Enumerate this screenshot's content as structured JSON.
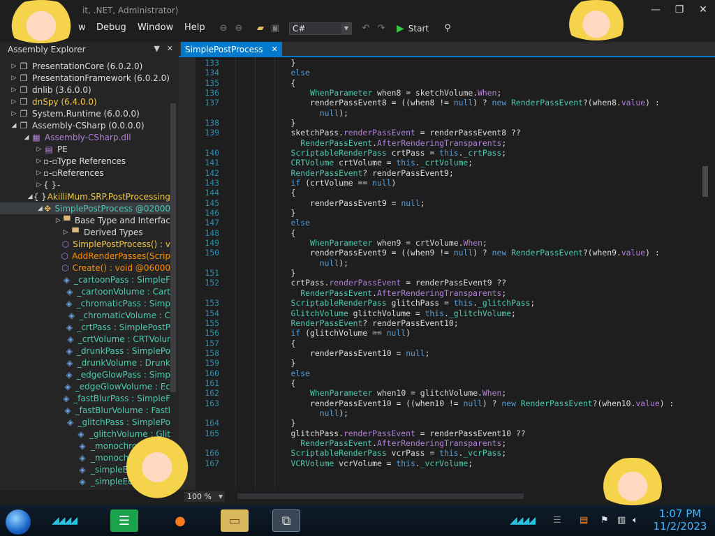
{
  "window": {
    "title": "dnSpy v6.4.0 (64-bit, .NET, Administrator)",
    "title_visible_fragment": "it, .NET, Administrator)",
    "controls": {
      "minimize": "—",
      "maximize": "❐",
      "close": "✕"
    }
  },
  "menu": {
    "items": [
      "w",
      "Debug",
      "Window",
      "Help"
    ]
  },
  "toolbar": {
    "language": "C#",
    "start_label": "Start"
  },
  "explorer": {
    "title": "Assembly Explorer",
    "items": [
      {
        "text": "PresentationCore (6.0.2.0)",
        "icon": "assembly-icon",
        "tw": "▷",
        "color": "c-white"
      },
      {
        "text": "PresentationFramework (6.0.2.0)",
        "icon": "assembly-icon",
        "tw": "▷",
        "color": "c-white"
      },
      {
        "text": "dnlib (3.6.0.0)",
        "icon": "assembly-icon",
        "tw": "▷",
        "color": "c-white"
      },
      {
        "text": "dnSpy (6.4.0.0)",
        "icon": "assembly-icon",
        "tw": "▷",
        "color": "c-yellow"
      },
      {
        "text": "System.Runtime (6.0.0.0)",
        "icon": "assembly-icon",
        "tw": "▷",
        "color": "c-white"
      },
      {
        "text": "Assembly-CSharp (0.0.0.0)",
        "icon": "assembly-icon",
        "tw": "◢",
        "color": "c-white"
      },
      {
        "text": "Assembly-CSharp.dll",
        "icon": "module-icon",
        "tw": "◢",
        "color": "c-purple"
      },
      {
        "text": "PE",
        "icon": "pe-icon",
        "tw": "▷",
        "color": "c-white"
      },
      {
        "text": "Type References",
        "icon": "reference-icon",
        "tw": "▷",
        "color": "c-white"
      },
      {
        "text": "References",
        "icon": "reference-icon",
        "tw": "▷",
        "color": "c-white"
      },
      {
        "text": "-",
        "icon": "namespace-icon",
        "tw": "▷",
        "color": "c-white"
      },
      {
        "text": "AkilliMum.SRP.PostProcessing",
        "icon": "namespace-icon",
        "tw": "◢",
        "color": "c-yellow"
      },
      {
        "text": "SimplePostProcess @02000",
        "icon": "class-icon",
        "tw": "◢",
        "color": "c-teal"
      },
      {
        "text": "Base Type and Interfac",
        "icon": "folder-icon",
        "tw": "▷",
        "color": "c-white"
      },
      {
        "text": "Derived Types",
        "icon": "folder-icon",
        "tw": "▷",
        "color": "c-white"
      },
      {
        "text": "SimplePostProcess() : v",
        "icon": "method-icon",
        "tw": "",
        "color": "c-yellow"
      },
      {
        "text": "AddRenderPasses(Scrip",
        "icon": "method-icon",
        "tw": "",
        "color": "c-orange"
      },
      {
        "text": "Create() : void @06000",
        "icon": "method-icon",
        "tw": "",
        "color": "c-orange"
      },
      {
        "text": "_cartoonPass : SimpleF",
        "icon": "field-icon",
        "tw": "",
        "color": "c-teal"
      },
      {
        "text": "_cartoonVolume : Cart",
        "icon": "field-icon",
        "tw": "",
        "color": "c-teal"
      },
      {
        "text": "_chromaticPass : Simp",
        "icon": "field-icon",
        "tw": "",
        "color": "c-teal"
      },
      {
        "text": "_chromaticVolume : C",
        "icon": "field-icon",
        "tw": "",
        "color": "c-teal"
      },
      {
        "text": "_crtPass : SimplePostP",
        "icon": "field-icon",
        "tw": "",
        "color": "c-teal"
      },
      {
        "text": "_crtVolume : CRTVolur",
        "icon": "field-icon",
        "tw": "",
        "color": "c-teal"
      },
      {
        "text": "_drunkPass : SimplePo",
        "icon": "field-icon",
        "tw": "",
        "color": "c-teal"
      },
      {
        "text": "_drunkVolume : Drunk",
        "icon": "field-icon",
        "tw": "",
        "color": "c-teal"
      },
      {
        "text": "_edgeGlowPass : Simp",
        "icon": "field-icon",
        "tw": "",
        "color": "c-teal"
      },
      {
        "text": "_edgeGlowVolume : Ec",
        "icon": "field-icon",
        "tw": "",
        "color": "c-teal"
      },
      {
        "text": "_fastBlurPass : SimpleF",
        "icon": "field-icon",
        "tw": "",
        "color": "c-teal"
      },
      {
        "text": "_fastBlurVolume : Fastl",
        "icon": "field-icon",
        "tw": "",
        "color": "c-teal"
      },
      {
        "text": "_glitchPass : SimplePo",
        "icon": "field-icon",
        "tw": "",
        "color": "c-teal"
      },
      {
        "text": "_glitchVolume : Glit",
        "icon": "field-icon",
        "tw": "",
        "color": "c-teal"
      },
      {
        "text": "_monochron",
        "icon": "field-icon",
        "tw": "",
        "color": "c-teal"
      },
      {
        "text": "_monochro",
        "icon": "field-icon",
        "tw": "",
        "color": "c-teal"
      },
      {
        "text": "_simpleEdge",
        "icon": "field-icon",
        "tw": "",
        "color": "c-teal"
      },
      {
        "text": "_simpleEdge",
        "icon": "field-icon",
        "tw": "",
        "color": "c-teal"
      }
    ]
  },
  "tab": {
    "label": "SimplePostProcess",
    "close": "✕"
  },
  "code": {
    "lines": [
      {
        "n": "133",
        "i": 4,
        "h": "}"
      },
      {
        "n": "134",
        "i": 4,
        "h": "<span class='kw'>else</span>"
      },
      {
        "n": "135",
        "i": 4,
        "h": "{"
      },
      {
        "n": "136",
        "i": 8,
        "h": "<span class='ty'>WhenParameter</span> when8 = sketchVolume.<span class='mem'>When</span>;"
      },
      {
        "n": "137",
        "i": 8,
        "h": "renderPassEvent8 = ((when8 != <span class='kw'>null</span>) ? <span class='kw'>new</span> <span class='ty'>RenderPassEvent</span>?(when8.<span class='mem'>value</span>) :"
      },
      {
        "n": "",
        "i": 10,
        "h": "<span class='kw'>null</span>);"
      },
      {
        "n": "138",
        "i": 4,
        "h": "}"
      },
      {
        "n": "139",
        "i": 4,
        "h": "sketchPass.<span class='mem'>renderPassEvent</span> = renderPassEvent8 ??"
      },
      {
        "n": "",
        "i": 6,
        "h": "<span class='ty'>RenderPassEvent</span>.<span class='mem'>AfterRenderingTransparents</span>;"
      },
      {
        "n": "140",
        "i": 4,
        "h": "<span class='ty'>ScriptableRenderPass</span> crtPass = <span class='kw'>this</span>.<span class='ty'>_crtPass</span>;"
      },
      {
        "n": "141",
        "i": 4,
        "h": "<span class='ty'>CRTVolume</span> crtVolume = <span class='kw'>this</span>.<span class='ty'>_crtVolume</span>;"
      },
      {
        "n": "142",
        "i": 4,
        "h": "<span class='ty'>RenderPassEvent</span>? renderPassEvent9;"
      },
      {
        "n": "143",
        "i": 4,
        "h": "<span class='kw'>if</span> (crtVolume == <span class='kw'>null</span>)"
      },
      {
        "n": "144",
        "i": 4,
        "h": "{"
      },
      {
        "n": "145",
        "i": 8,
        "h": "renderPassEvent9 = <span class='kw'>null</span>;"
      },
      {
        "n": "146",
        "i": 4,
        "h": "}"
      },
      {
        "n": "147",
        "i": 4,
        "h": "<span class='kw'>else</span>"
      },
      {
        "n": "148",
        "i": 4,
        "h": "{"
      },
      {
        "n": "149",
        "i": 8,
        "h": "<span class='ty'>WhenParameter</span> when9 = crtVolume.<span class='mem'>When</span>;"
      },
      {
        "n": "150",
        "i": 8,
        "h": "renderPassEvent9 = ((when9 != <span class='kw'>null</span>) ? <span class='kw'>new</span> <span class='ty'>RenderPassEvent</span>?(when9.<span class='mem'>value</span>) :"
      },
      {
        "n": "",
        "i": 10,
        "h": "<span class='kw'>null</span>);"
      },
      {
        "n": "151",
        "i": 4,
        "h": "}"
      },
      {
        "n": "152",
        "i": 4,
        "h": "crtPass.<span class='mem'>renderPassEvent</span> = renderPassEvent9 ??"
      },
      {
        "n": "",
        "i": 6,
        "h": "<span class='ty'>RenderPassEvent</span>.<span class='mem'>AfterRenderingTransparents</span>;"
      },
      {
        "n": "153",
        "i": 4,
        "h": "<span class='ty'>ScriptableRenderPass</span> glitchPass = <span class='kw'>this</span>.<span class='ty'>_glitchPass</span>;"
      },
      {
        "n": "154",
        "i": 4,
        "h": "<span class='ty'>GlitchVolume</span> glitchVolume = <span class='kw'>this</span>.<span class='ty'>_glitchVolume</span>;"
      },
      {
        "n": "155",
        "i": 4,
        "h": "<span class='ty'>RenderPassEvent</span>? renderPassEvent10;"
      },
      {
        "n": "156",
        "i": 4,
        "h": "<span class='kw'>if</span> (glitchVolume == <span class='kw'>null</span>)"
      },
      {
        "n": "157",
        "i": 4,
        "h": "{"
      },
      {
        "n": "158",
        "i": 8,
        "h": "renderPassEvent10 = <span class='kw'>null</span>;"
      },
      {
        "n": "159",
        "i": 4,
        "h": "}"
      },
      {
        "n": "160",
        "i": 4,
        "h": "<span class='kw'>else</span>"
      },
      {
        "n": "161",
        "i": 4,
        "h": "{"
      },
      {
        "n": "162",
        "i": 8,
        "h": "<span class='ty'>WhenParameter</span> when10 = glitchVolume.<span class='mem'>When</span>;"
      },
      {
        "n": "163",
        "i": 8,
        "h": "renderPassEvent10 = ((when10 != <span class='kw'>null</span>) ? <span class='kw'>new</span> <span class='ty'>RenderPassEvent</span>?(when10.<span class='mem'>value</span>) :"
      },
      {
        "n": "",
        "i": 10,
        "h": "<span class='kw'>null</span>);"
      },
      {
        "n": "164",
        "i": 4,
        "h": "}"
      },
      {
        "n": "165",
        "i": 4,
        "h": "glitchPass.<span class='mem'>renderPassEvent</span> = renderPassEvent10 ??"
      },
      {
        "n": "",
        "i": 6,
        "h": "<span class='ty'>RenderPassEvent</span>.<span class='mem'>AfterRenderingTransparents</span>;"
      },
      {
        "n": "166",
        "i": 4,
        "h": "<span class='ty'>ScriptableRenderPass</span> vcrPass = <span class='kw'>this</span>.<span class='ty'>_vcrPass</span>;"
      },
      {
        "n": "167",
        "i": 4,
        "h": "<span class='ty'>VCRVolume</span> vcrVolume = <span class='kw'>this</span>.<span class='ty'>_vcrVolume</span>;"
      }
    ]
  },
  "status": {
    "zoom": "100 %"
  },
  "taskbar": {
    "time": "1:07 PM",
    "date": "11/2/2023",
    "tray_icons": [
      "network-icon",
      "flag-icon",
      "volume-icon"
    ],
    "colors": {
      "clock": "#46b4ff",
      "accent": "#007acc"
    }
  }
}
